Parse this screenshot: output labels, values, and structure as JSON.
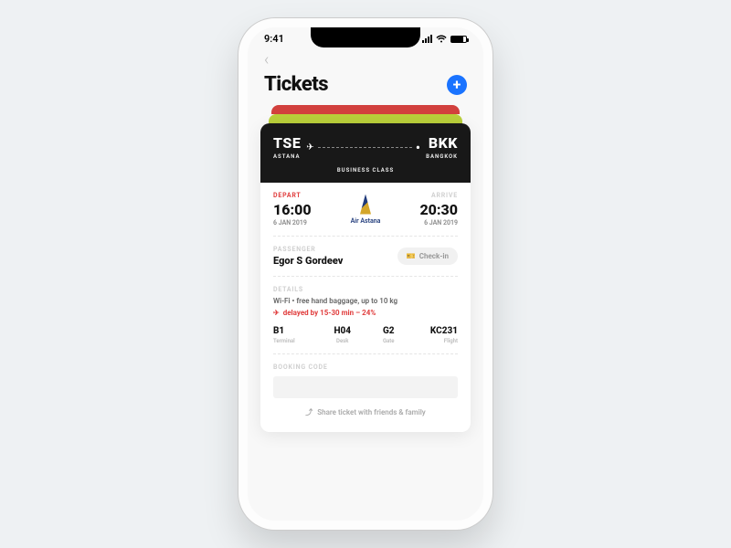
{
  "status": {
    "time": "9:41"
  },
  "header": {
    "title": "Tickets"
  },
  "ticket": {
    "from_code": "TSE",
    "from_city": "ASTANA",
    "to_code": "BKK",
    "to_city": "BANGKOK",
    "travel_class": "BUSINESS CLASS",
    "depart_label": "DEPART",
    "depart_time": "16:00",
    "depart_date": "6 JAN 2019",
    "arrive_label": "ARRIVE",
    "arrive_time": "20:30",
    "arrive_date": "6 JAN 2019",
    "airline": "Air Astana",
    "passenger_label": "Passenger",
    "passenger_name": "Egor S Gordeev",
    "checkin_label": "Check-in",
    "details_label": "Details",
    "details_text": "Wi-Fi • free hand baggage, up to 10 kg",
    "delay_text": "delayed by 15-30 min – 24%",
    "terminal": "B1",
    "terminal_label": "Terminal",
    "desk": "H04",
    "desk_label": "Desk",
    "gate": "G2",
    "gate_label": "Gate",
    "flight": "KC231",
    "flight_label": "Flight",
    "booking_label": "Booking Code",
    "share_label": "Share ticket with friends & family"
  },
  "colors": {
    "accent": "#1a73ff",
    "danger": "#e03c3c"
  }
}
